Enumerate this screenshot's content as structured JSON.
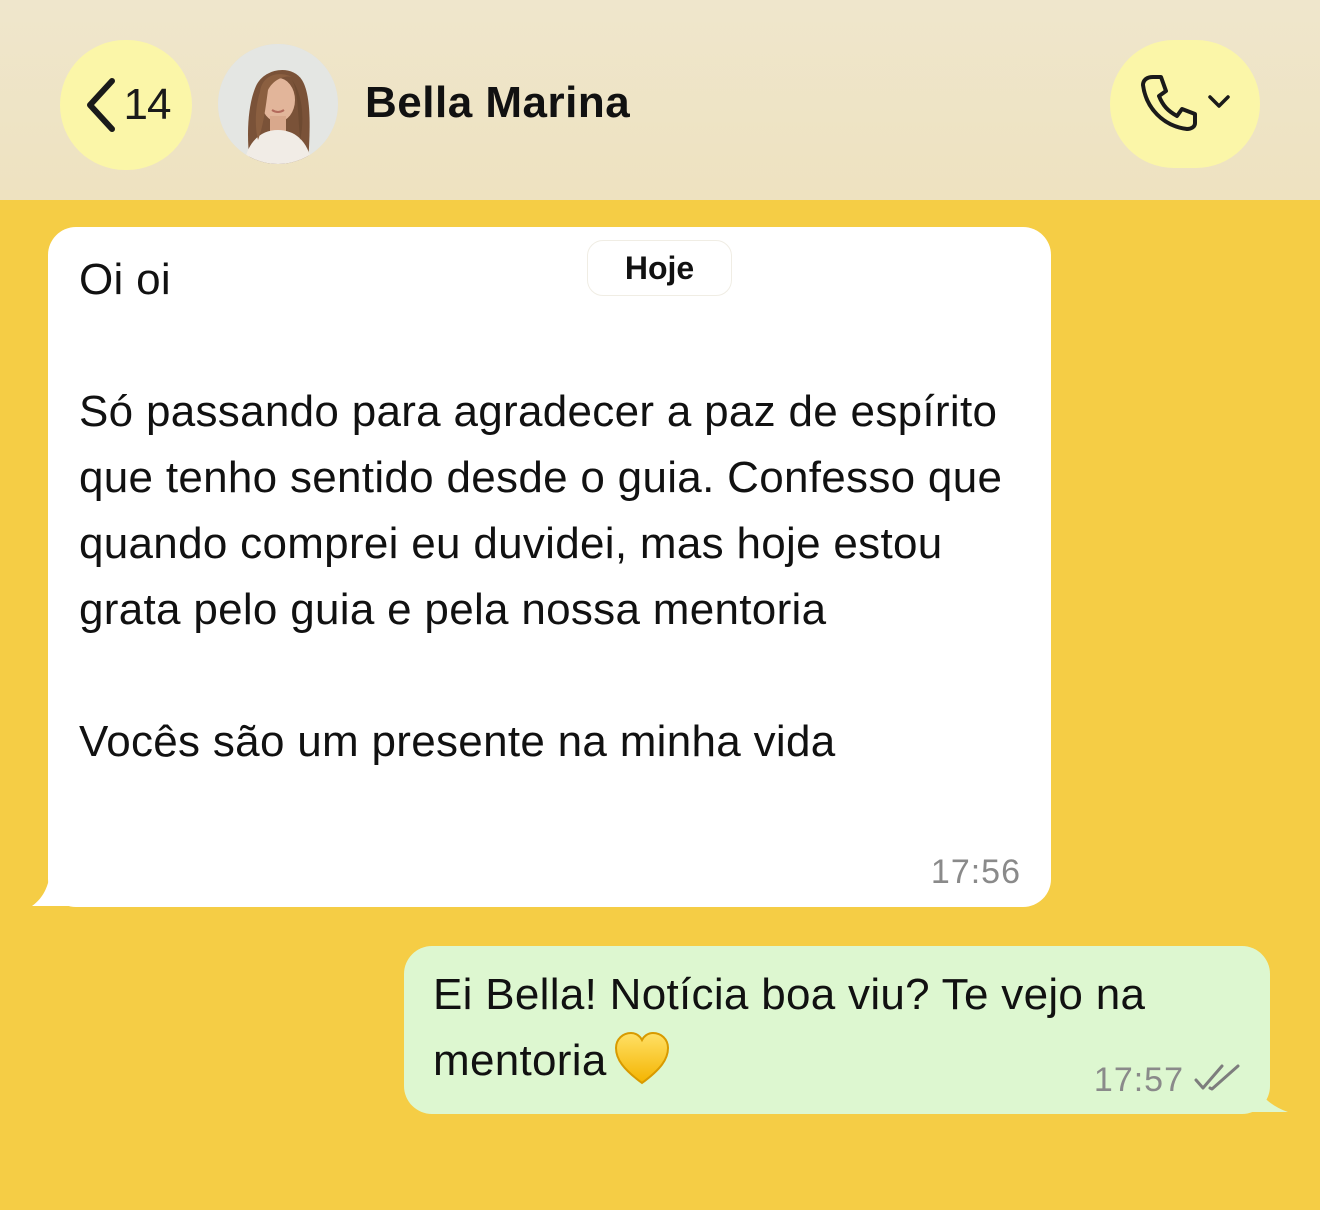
{
  "header": {
    "back_count": "14",
    "contact_name": "Bella Marina",
    "avatar_icon": "contact-avatar",
    "call_icon": "phone-icon",
    "call_dropdown_icon": "chevron-down-icon"
  },
  "date_separator": "Hoje",
  "messages": [
    {
      "direction": "incoming",
      "text": "Oi oi\n\nSó passando para agradecer a paz de espírito que tenho sentido desde o guia. Confesso que quando comprei eu duvidei, mas hoje estou grata pelo guia e pela nossa mentoria\n\nVocês são um presente na minha vida",
      "time": "17:56"
    },
    {
      "direction": "outgoing",
      "text": "Ei Bella! Notícia boa viu? Te vejo na mentoria",
      "emoji": "yellow-heart",
      "time": "17:57",
      "status": "read-double-check"
    }
  ],
  "colors": {
    "chat_background": "#f5cd45",
    "header_background": "#eee2c0",
    "header_buttons": "#fbf6a8",
    "incoming_bubble": "#ffffff",
    "outgoing_bubble": "#ddf7d0"
  }
}
